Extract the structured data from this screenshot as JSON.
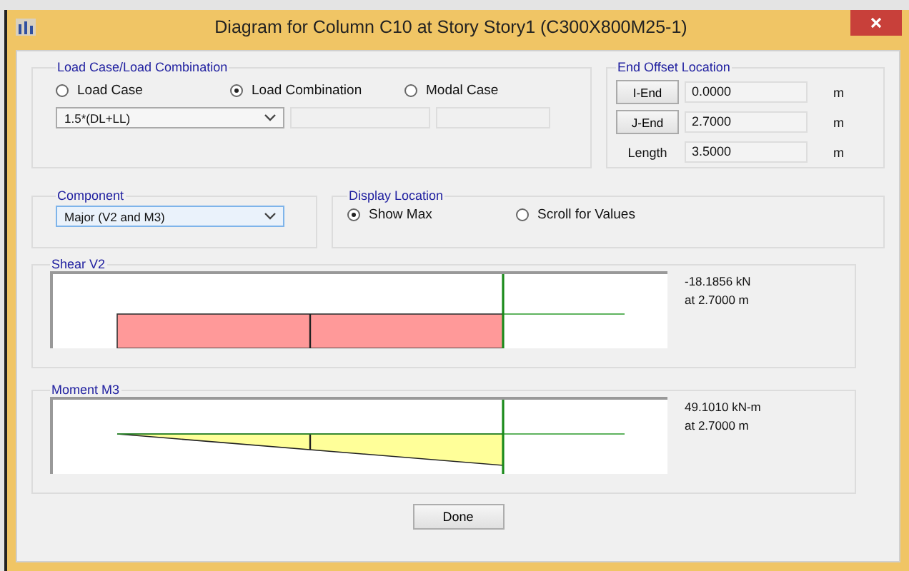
{
  "window": {
    "title": "Diagram for Column C10 at Story Story1 (C300X800M25-1)"
  },
  "load_group": {
    "title": "Load Case/Load Combination",
    "options": [
      {
        "label": "Load Case",
        "selected": false
      },
      {
        "label": "Load Combination",
        "selected": true
      },
      {
        "label": "Modal Case",
        "selected": false
      }
    ],
    "combo_value": "1.5*(DL+LL)"
  },
  "end_offset": {
    "title": "End Offset Location",
    "rows": [
      {
        "kind": "button",
        "label": "I-End",
        "value": "0.0000",
        "unit": "m"
      },
      {
        "kind": "button",
        "label": "J-End",
        "value": "2.7000",
        "unit": "m"
      },
      {
        "kind": "label",
        "label": "Length",
        "value": "3.5000",
        "unit": "m"
      }
    ]
  },
  "component": {
    "title": "Component",
    "value": "Major (V2 and M3)"
  },
  "display_location": {
    "title": "Display Location",
    "options": [
      {
        "label": "Show Max",
        "selected": true
      },
      {
        "label": "Scroll for Values",
        "selected": false
      }
    ]
  },
  "diagrams": [
    {
      "title": "Shear V2",
      "kind": "rect",
      "color": "#ff9999",
      "value": "-18.1856 kN",
      "location": "at 2.7000 m"
    },
    {
      "title": "Moment M3",
      "kind": "triangle",
      "color": "#ffff99",
      "value": "49.1010 kN-m",
      "location": "at 2.7000 m"
    }
  ],
  "buttons": [
    "Done"
  ]
}
